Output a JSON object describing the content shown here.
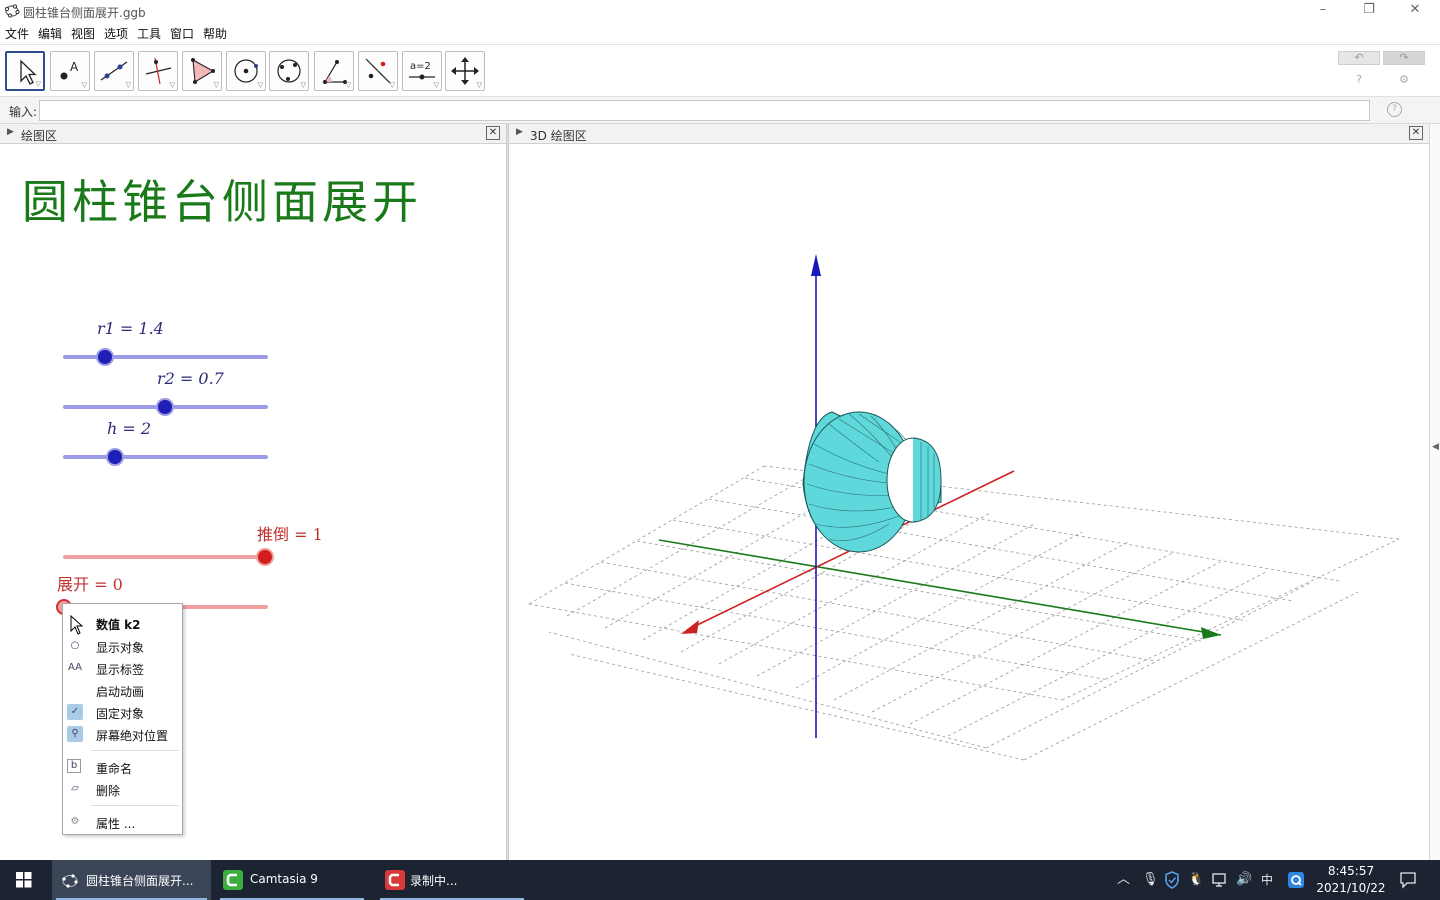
{
  "window": {
    "title": "圆柱锥台侧面展开.ggb",
    "controls": [
      "–",
      "❐",
      "✕"
    ]
  },
  "menu": [
    "文件",
    "编辑",
    "视图",
    "选项",
    "工具",
    "窗口",
    "帮助"
  ],
  "toolbar": {
    "tools": [
      "move-tool",
      "point-tool",
      "line-tool",
      "perpendicular-line-tool",
      "polygon-tool",
      "circle-tool",
      "conic-tool",
      "angle-tool",
      "reflect-tool",
      "slider-tool",
      "move-graphics-view-tool"
    ],
    "slider_tool_text": "a=2",
    "undo_icon": "undo-icon",
    "redo_icon": "redo-icon"
  },
  "input_bar": {
    "label": "输入:",
    "value": "",
    "placeholder": ""
  },
  "graphics_panel": {
    "header": "绘图区",
    "title": "圆柱锥台侧面展开",
    "sliders": [
      {
        "label": "r1 = 1.4",
        "value": 1.4,
        "fraction": 0.21,
        "color": "#2020b8"
      },
      {
        "label": "r2 = 0.7",
        "value": 0.7,
        "fraction": 0.5,
        "color": "#2020b8"
      },
      {
        "label": "h = 2",
        "value": 2,
        "fraction": 0.25,
        "color": "#2020b8"
      },
      {
        "label": "推倒 = 1",
        "value": 1,
        "fraction": 1.0,
        "color": "#d41e1e"
      },
      {
        "label": "展开 = 0",
        "value": 0,
        "fraction": 0.0,
        "color": "#d41e1e"
      }
    ]
  },
  "view3d_panel": {
    "header": "3D 绘图区",
    "axis_colors": {
      "x": "#cc2222",
      "y": "#1a7a1a",
      "z": "#1a1ab8"
    },
    "surface_color": "#5fd8dc"
  },
  "context_menu": {
    "items": [
      {
        "label": "数值 k2",
        "icon": "",
        "checked": false,
        "header": true
      },
      {
        "label": "显示对象",
        "icon": "show-object-icon",
        "checked": false
      },
      {
        "label": "显示标签",
        "icon": "show-label-icon",
        "checked": false
      },
      {
        "label": "启动动画",
        "icon": "",
        "checked": false
      },
      {
        "label": "固定对象",
        "icon": "check-icon",
        "checked": true
      },
      {
        "label": "屏幕绝对位置",
        "icon": "pin-icon",
        "checked": true
      },
      {
        "label": "重命名",
        "icon": "rename-icon",
        "checked": false
      },
      {
        "label": "删除",
        "icon": "eraser-icon",
        "checked": false
      },
      {
        "label": "属性 ...",
        "icon": "gear-icon",
        "checked": false
      }
    ]
  },
  "taskbar": {
    "apps": [
      {
        "label": "圆柱锥台侧面展开...",
        "active": true
      },
      {
        "label": "Camtasia 9",
        "active": false
      },
      {
        "label": "录制中...",
        "active": false
      }
    ],
    "ime": "中",
    "time": "8:45:57",
    "date": "2021/10/22"
  }
}
